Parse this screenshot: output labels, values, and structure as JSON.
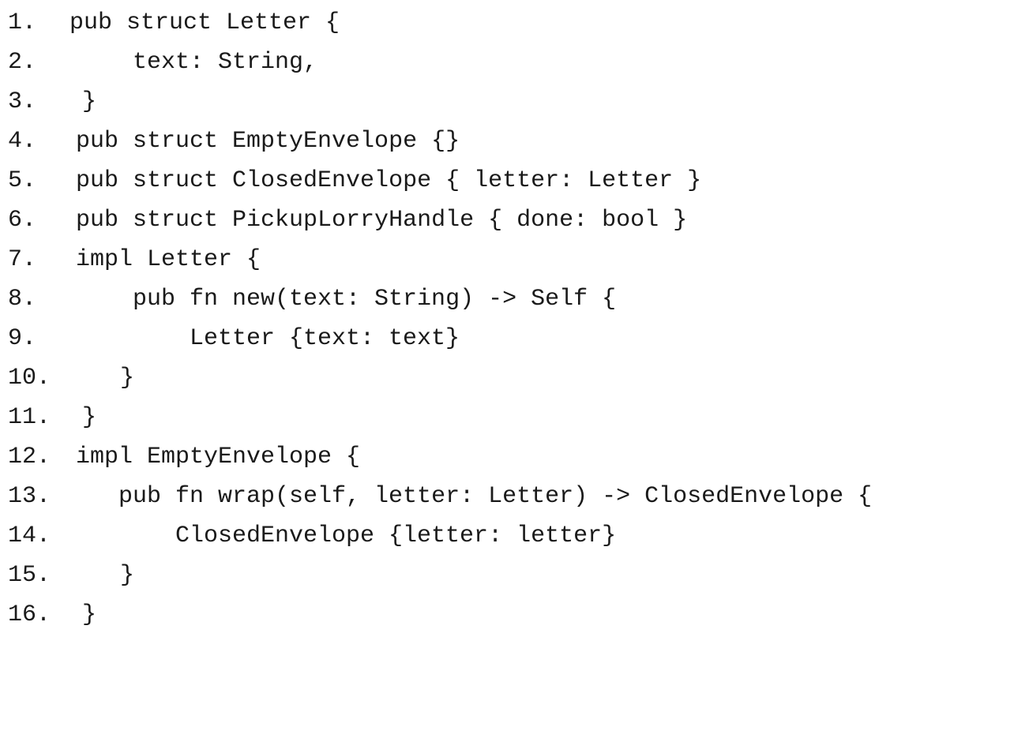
{
  "code": {
    "lines": [
      {
        "number": "1.",
        "text": "pub struct Letter {"
      },
      {
        "number": "2.",
        "text": "text: String,"
      },
      {
        "number": "3.",
        "text": "}"
      },
      {
        "number": "4.",
        "text": "pub struct EmptyEnvelope {}"
      },
      {
        "number": "5.",
        "text": "pub struct ClosedEnvelope { letter: Letter }"
      },
      {
        "number": "6.",
        "text": "pub struct PickupLorryHandle { done: bool }"
      },
      {
        "number": "7.",
        "text": "impl Letter {"
      },
      {
        "number": "8.",
        "text": "pub fn new(text: String) -> Self {"
      },
      {
        "number": "9.",
        "text": "Letter {text: text}"
      },
      {
        "number": "10.",
        "text": "}"
      },
      {
        "number": "11.",
        "text": "}"
      },
      {
        "number": "12.",
        "text": "impl EmptyEnvelope {"
      },
      {
        "number": "13.",
        "text": "pub fn wrap(self, letter: Letter) -> ClosedEnvelope {"
      },
      {
        "number": "14.",
        "text": "ClosedEnvelope {letter: letter}"
      },
      {
        "number": "15.",
        "text": "}"
      },
      {
        "number": "16.",
        "text": "}"
      }
    ]
  }
}
